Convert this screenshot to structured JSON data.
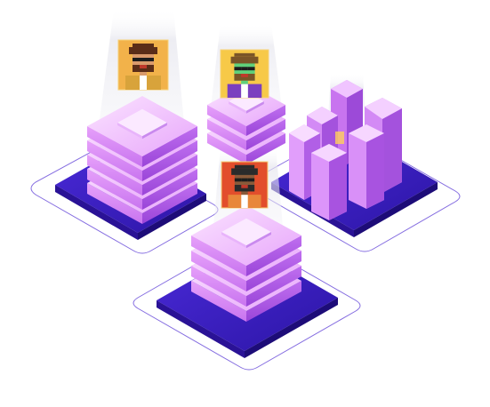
{
  "colors": {
    "outline": "#5b3bd6",
    "base_top": "#3f1fc9",
    "base_side": "#2a1296",
    "block_top": "#f3c8ff",
    "block_mid": "#d98cf5",
    "block_side": "#b65ee8",
    "block_shadow": "#8f3fd0",
    "beam": "#e8e8ef",
    "glow": "#ffd66b"
  },
  "avatars": [
    {
      "name": "avatar-bearded-man",
      "bg": "#f2b24a",
      "skin": "#d99a6c",
      "hair": "#5a2d18",
      "shirt": "#d8a33b",
      "glasses": "#1d1d1d"
    },
    {
      "name": "avatar-green-alien",
      "bg": "#f7c948",
      "skin": "#5fd07a",
      "hair": "#7a5528",
      "shirt": "#7b3fbf",
      "glasses": "#1d1d1d"
    },
    {
      "name": "avatar-hat-man",
      "bg": "#e24e2c",
      "skin": "#8a5a3a",
      "hair": "#2b2b2b",
      "shirt": "#e8873a",
      "glasses": "#1d1d1d"
    }
  ]
}
